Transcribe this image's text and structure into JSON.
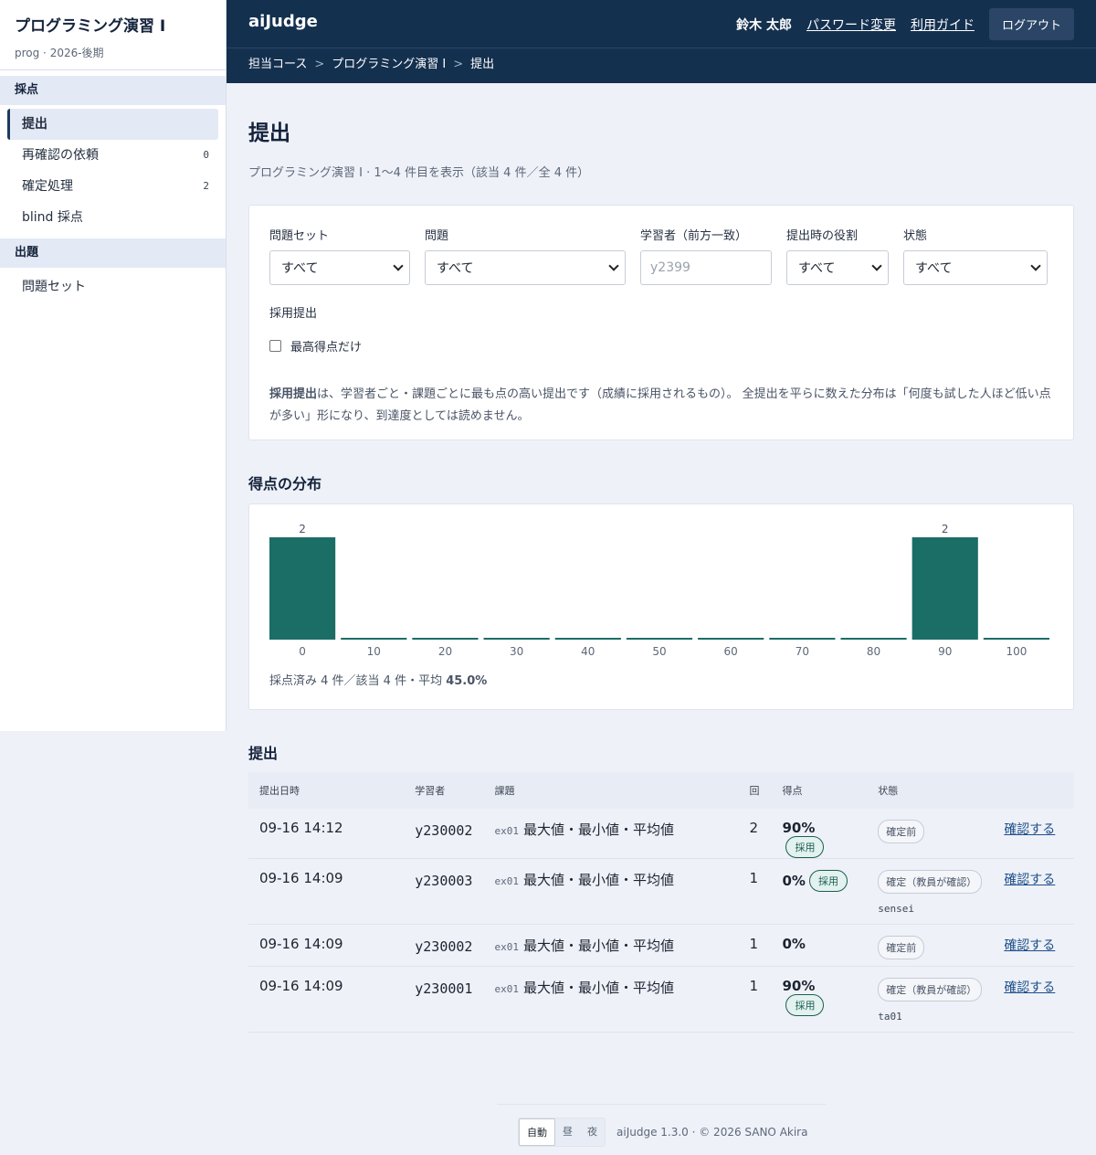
{
  "sidebar": {
    "course_title": "プログラミング演習 I",
    "course_sub": "prog · 2026-後期",
    "sections": [
      {
        "label": "採点"
      },
      {
        "label": "出題"
      }
    ],
    "grading_items": [
      {
        "label": "提出",
        "count": ""
      },
      {
        "label": "再確認の依頼",
        "count": "0"
      },
      {
        "label": "確定処理",
        "count": "2"
      },
      {
        "label": "blind 採点",
        "count": ""
      }
    ],
    "authoring_items": [
      {
        "label": "問題セット"
      }
    ]
  },
  "header": {
    "brand": "aiJudge",
    "user": "鈴木 太郎",
    "password_link": "パスワード変更",
    "guide_link": "利用ガイド",
    "logout": "ログアウト"
  },
  "breadcrumb": {
    "items": [
      "担当コース",
      "プログラミング演習 I",
      "提出"
    ],
    "sep": ">"
  },
  "page": {
    "title": "提出",
    "subtitle": "プログラミング演習 I · 1〜4 件目を表示（該当 4 件／全 4 件）"
  },
  "filters": {
    "problem_set": {
      "label": "問題セット",
      "value": "すべて"
    },
    "problem": {
      "label": "問題",
      "value": "すべて"
    },
    "learner": {
      "label": "学習者（前方一致）",
      "placeholder": "y2399",
      "value": ""
    },
    "role": {
      "label": "提出時の役割",
      "value": "すべて"
    },
    "status": {
      "label": "状態",
      "value": "すべて"
    },
    "adopt_label": "採用提出",
    "best_only_label": "最高得点だけ",
    "note_bold": "採用提出",
    "note_text": "は、学習者ごと・課題ごとに最も点の高い提出です（成績に採用されるもの）。 全提出を平らに数えた分布は「何度も試した人ほど低い点が多い」形になり、到達度としては読めません。"
  },
  "distribution": {
    "heading": "得点の分布",
    "summary_prefix": "採点済み 4 件／該当 4 件・平均 ",
    "summary_avg": "45.0%"
  },
  "chart_data": {
    "type": "bar",
    "categories": [
      "0",
      "10",
      "20",
      "30",
      "40",
      "50",
      "60",
      "70",
      "80",
      "90",
      "100"
    ],
    "values": [
      2,
      0,
      0,
      0,
      0,
      0,
      0,
      0,
      0,
      2,
      0
    ],
    "data_labels": [
      "2",
      "",
      "",
      "",
      "",
      "",
      "",
      "",
      "",
      "2",
      ""
    ],
    "color": "#1b6e66"
  },
  "submissions": {
    "heading": "提出",
    "columns": [
      "提出日時",
      "学習者",
      "課題",
      "回",
      "得点",
      "状態",
      ""
    ],
    "rows": [
      {
        "time": "09-16 14:12",
        "learner": "y230002",
        "code": "ex01",
        "task": "最大値・最小値・平均値",
        "attempt": "2",
        "score": "90%",
        "adopted": "採用",
        "status": "確定前",
        "confirmer": "",
        "action": "確認する"
      },
      {
        "time": "09-16 14:09",
        "learner": "y230003",
        "code": "ex01",
        "task": "最大値・最小値・平均値",
        "attempt": "1",
        "score": "0%",
        "adopted": "採用",
        "status": "確定（教員が確認）",
        "confirmer": "sensei",
        "action": "確認する"
      },
      {
        "time": "09-16 14:09",
        "learner": "y230002",
        "code": "ex01",
        "task": "最大値・最小値・平均値",
        "attempt": "1",
        "score": "0%",
        "adopted": "",
        "status": "確定前",
        "confirmer": "",
        "action": "確認する"
      },
      {
        "time": "09-16 14:09",
        "learner": "y230001",
        "code": "ex01",
        "task": "最大値・最小値・平均値",
        "attempt": "1",
        "score": "90%",
        "adopted": "採用",
        "status": "確定（教員が確認）",
        "confirmer": "ta01",
        "action": "確認する"
      }
    ]
  },
  "footer": {
    "themes": [
      "自動",
      "昼",
      "夜"
    ],
    "text": "aiJudge 1.3.0 · © 2026 SANO Akira"
  }
}
